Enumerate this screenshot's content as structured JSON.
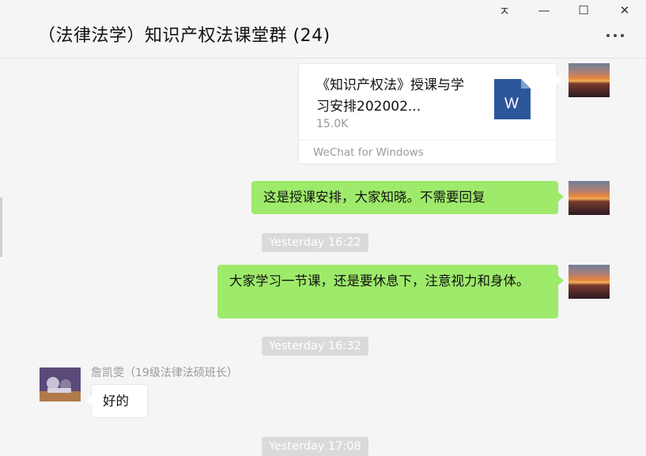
{
  "window": {
    "pin_glyph": "ㅈ",
    "minimize_glyph": "—",
    "maximize_glyph": "☐",
    "close_glyph": "✕"
  },
  "chat": {
    "title": "（法律法学）知识产权法课堂群 (24)"
  },
  "messages": {
    "file": {
      "name": "《知识产权法》授课与学习安排202002...",
      "size": "15.0K",
      "source": "WeChat for Windows",
      "icon": "word-doc-icon",
      "icon_letter": "W"
    },
    "msg1": "这是授课安排，大家知晓。不需要回复",
    "time1": "Yesterday 16:22",
    "msg2": "大家学习一节课，还是要休息下，注意视力和身体。",
    "time2": "Yesterday 16:32",
    "sender3": "詹凯雯（19级法律法硕班长）",
    "msg3": "好的",
    "time3": "Yesterday 17:08"
  },
  "colors": {
    "self_bubble": "#9eea6a",
    "other_bubble": "#ffffff",
    "background": "#f5f5f5",
    "word_blue": "#2b579a"
  }
}
